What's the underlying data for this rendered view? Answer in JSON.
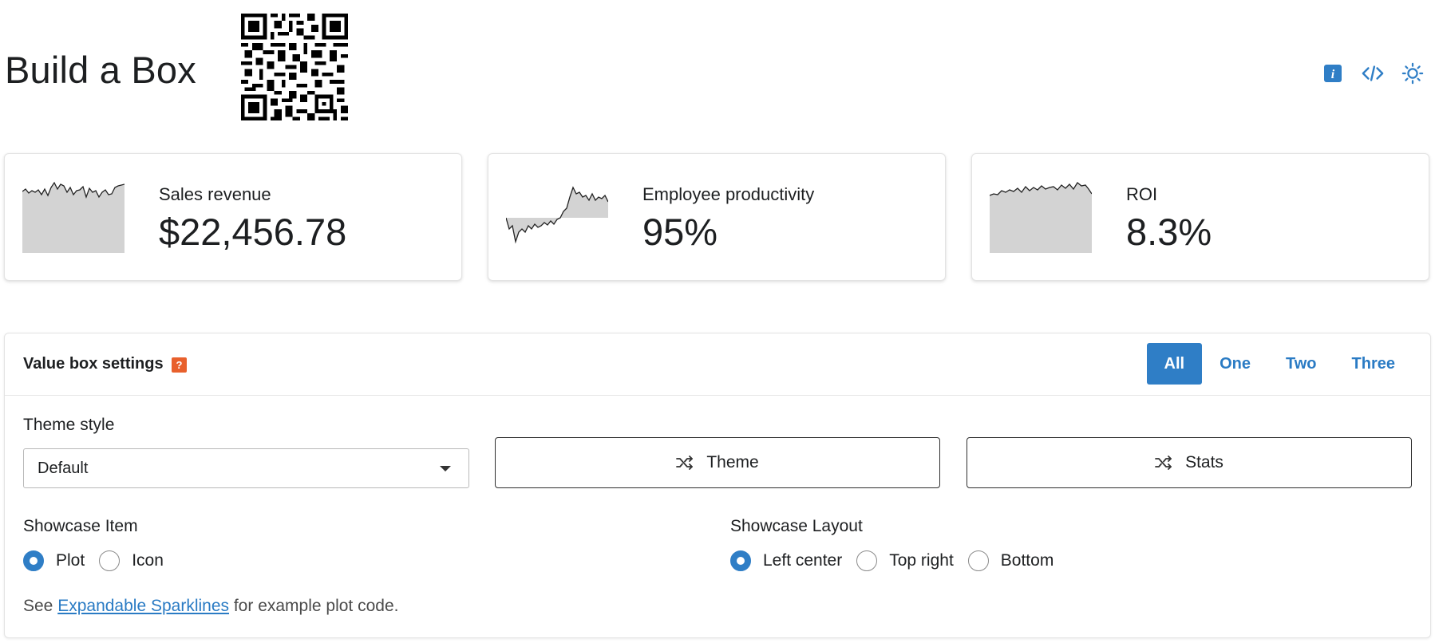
{
  "page": {
    "title": "Build a Box"
  },
  "header_icons": [
    "info-icon",
    "code-icon",
    "sun-icon"
  ],
  "value_boxes": [
    {
      "title": "Sales revenue",
      "value": "$22,456.78",
      "icon": "sparkline-area"
    },
    {
      "title": "Employee productivity",
      "value": "95%",
      "icon": "sparkline-area"
    },
    {
      "title": "ROI",
      "value": "8.3%",
      "icon": "sparkline-area"
    }
  ],
  "settings": {
    "title": "Value box settings",
    "help_badge": "?",
    "tabs": [
      {
        "label": "All",
        "active": true
      },
      {
        "label": "One",
        "active": false
      },
      {
        "label": "Two",
        "active": false
      },
      {
        "label": "Three",
        "active": false
      }
    ],
    "theme_style": {
      "label": "Theme style",
      "selected": "Default"
    },
    "buttons": {
      "theme": "Theme",
      "stats": "Stats"
    },
    "showcase_item": {
      "label": "Showcase Item",
      "options": [
        "Plot",
        "Icon"
      ],
      "selected": "Plot"
    },
    "showcase_layout": {
      "label": "Showcase Layout",
      "options": [
        "Left center",
        "Top right",
        "Bottom"
      ],
      "selected": "Left center"
    },
    "footnote": {
      "prefix": "See ",
      "link": "Expandable Sparklines",
      "suffix": " for example plot code."
    }
  },
  "colors": {
    "accent": "#2f7ec6",
    "help_badge": "#e8602c",
    "sparkline_fill": "#d3d3d3"
  }
}
